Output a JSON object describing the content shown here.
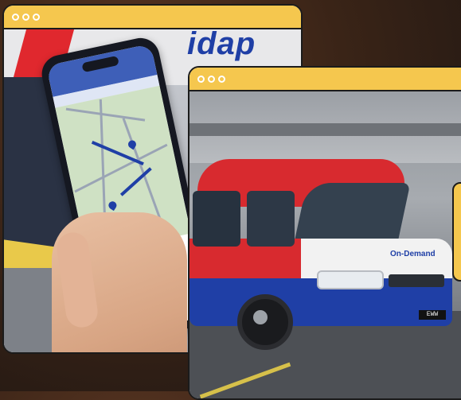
{
  "windows": {
    "back": {
      "photo": "phone-map-app-photo",
      "brand_fragment": "idap"
    },
    "front": {
      "photo": "van-photo",
      "van_logo": "On-Demand",
      "plate": "EWW"
    }
  },
  "colors": {
    "titlebar": "#f5c74e",
    "border": "#1b1b1b",
    "van_red": "#d82a2f",
    "van_blue": "#1f3fa6"
  },
  "icons": [
    "window-dots-icon"
  ]
}
